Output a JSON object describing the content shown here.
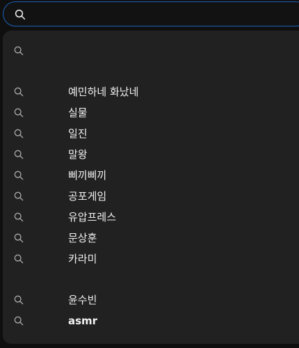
{
  "search": {
    "value": "",
    "placeholder": "",
    "icon": "search-icon",
    "focus_color": "#1c62b9"
  },
  "suggestions": [
    {
      "text": ""
    },
    {
      "text": "예민하네 화났네"
    },
    {
      "text": "실물"
    },
    {
      "text": "일진"
    },
    {
      "text": "말왕"
    },
    {
      "text": "삐끼삐끼"
    },
    {
      "text": "공포게임"
    },
    {
      "text": "유압프레스"
    },
    {
      "text": "문상훈"
    },
    {
      "text": "카라미"
    },
    {
      "text": "윤수빈"
    },
    {
      "text": "asmr"
    }
  ],
  "colors": {
    "background": "#0f0f0f",
    "panel": "#212121",
    "text": "#f1f1f1",
    "icon": "#aaaaaa"
  }
}
